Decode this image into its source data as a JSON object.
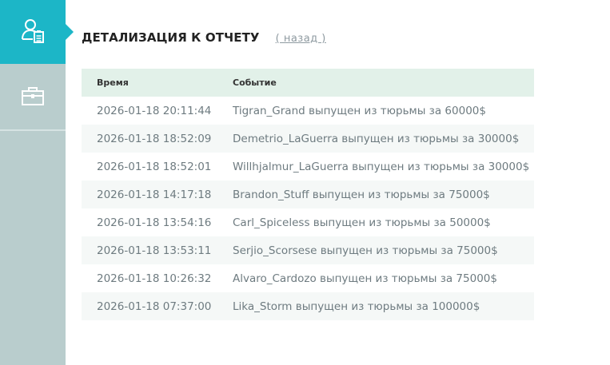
{
  "sidebar": {
    "items": [
      {
        "icon": "user-report-icon",
        "active": true
      },
      {
        "icon": "briefcase-icon",
        "active": false
      }
    ]
  },
  "header": {
    "title": "ДЕТАЛИЗАЦИЯ К ОТЧЕТУ",
    "back_label": "( назад )"
  },
  "table": {
    "columns": [
      "Время",
      "Событие"
    ],
    "rows": [
      {
        "time": "2026-01-18 20:11:44",
        "event": "Tigran_Grand выпущен из тюрьмы за 60000$"
      },
      {
        "time": "2026-01-18 18:52:09",
        "event": "Demetrio_LaGuerra выпущен из тюрьмы за 30000$"
      },
      {
        "time": "2026-01-18 18:52:01",
        "event": "Willhjalmur_LaGuerra выпущен из тюрьмы за 30000$"
      },
      {
        "time": "2026-01-18 14:17:18",
        "event": "Brandon_Stuff выпущен из тюрьмы за 75000$"
      },
      {
        "time": "2026-01-18 13:54:16",
        "event": "Carl_Spiceless выпущен из тюрьмы за 50000$"
      },
      {
        "time": "2026-01-18 13:53:11",
        "event": "Serjio_Scorsese выпущен из тюрьмы за 75000$"
      },
      {
        "time": "2026-01-18 10:26:32",
        "event": "Alvaro_Cardozo выпущен из тюрьмы за 75000$"
      },
      {
        "time": "2026-01-18 07:37:00",
        "event": "Lika_Storm выпущен из тюрьмы за 100000$"
      }
    ]
  },
  "colors": {
    "accent": "#1cb6c7",
    "sidebar": "#b9cdcd",
    "header_row": "#e2f1e9",
    "stripe": "#f5f8f7"
  }
}
